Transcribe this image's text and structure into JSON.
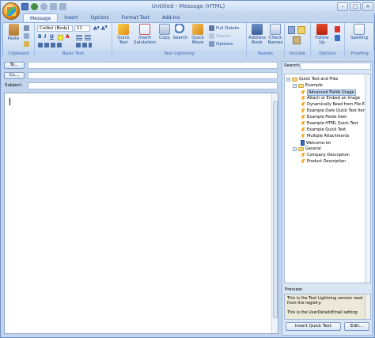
{
  "window": {
    "title": "Untitled - Message (HTML)"
  },
  "tabs": [
    "Message",
    "Insert",
    "Options",
    "Format Text",
    "Add-Ins"
  ],
  "ribbon": {
    "clipboard": {
      "paste": "Paste",
      "label": "Clipboard"
    },
    "basic_text": {
      "font": "Calibri (Body)",
      "size": "11",
      "label": "Basic Text"
    },
    "text_lightning": {
      "quick_text": "Quick Text",
      "insert_salutation": "Insert Salutation",
      "copy": "Copy",
      "search": "Search",
      "quick_move": "Quick Move",
      "full_delete": "Full Delete",
      "search_small": "Search",
      "options": "Options",
      "label": "Text Lightning"
    },
    "names": {
      "address_book": "Address Book",
      "check_names": "Check Names",
      "label": "Names"
    },
    "include": {
      "label": "Include"
    },
    "options": {
      "follow_up": "Follow Up",
      "label": "Options"
    },
    "proofing": {
      "spelling": "Spelling",
      "label": "Proofing"
    }
  },
  "address": {
    "to": "To...",
    "cc": "Cc...",
    "subject": "Subject:"
  },
  "side_panel": {
    "search_label": "Search:",
    "tree": [
      {
        "label": "Quick Text and Files",
        "type": "root"
      },
      {
        "label": "Example",
        "type": "folder"
      },
      {
        "label": "Advanced Fields Usage",
        "type": "item",
        "selected": true
      },
      {
        "label": "Attach or Embed an Image",
        "type": "item"
      },
      {
        "label": "Dynamically Read from File Exa",
        "type": "item"
      },
      {
        "label": "Example Date Quick Text Item",
        "type": "item"
      },
      {
        "label": "Example Fields Item",
        "type": "item"
      },
      {
        "label": "Example HTML Quick Text",
        "type": "item"
      },
      {
        "label": "Example Quick Text",
        "type": "item"
      },
      {
        "label": "Multiple Attachments",
        "type": "item"
      },
      {
        "label": "Welcome.txt",
        "type": "file"
      },
      {
        "label": "General",
        "type": "folder"
      },
      {
        "label": "Company Description",
        "type": "item"
      },
      {
        "label": "Product Description",
        "type": "item"
      }
    ],
    "preview_label": "Preview:",
    "preview_lines": [
      "This is the Text Lightning version read",
      "from the registry:",
      "",
      "This is the UserDetailsEmail setting"
    ],
    "insert_button": "Insert Quick Text",
    "edit_button": "Edit..."
  }
}
